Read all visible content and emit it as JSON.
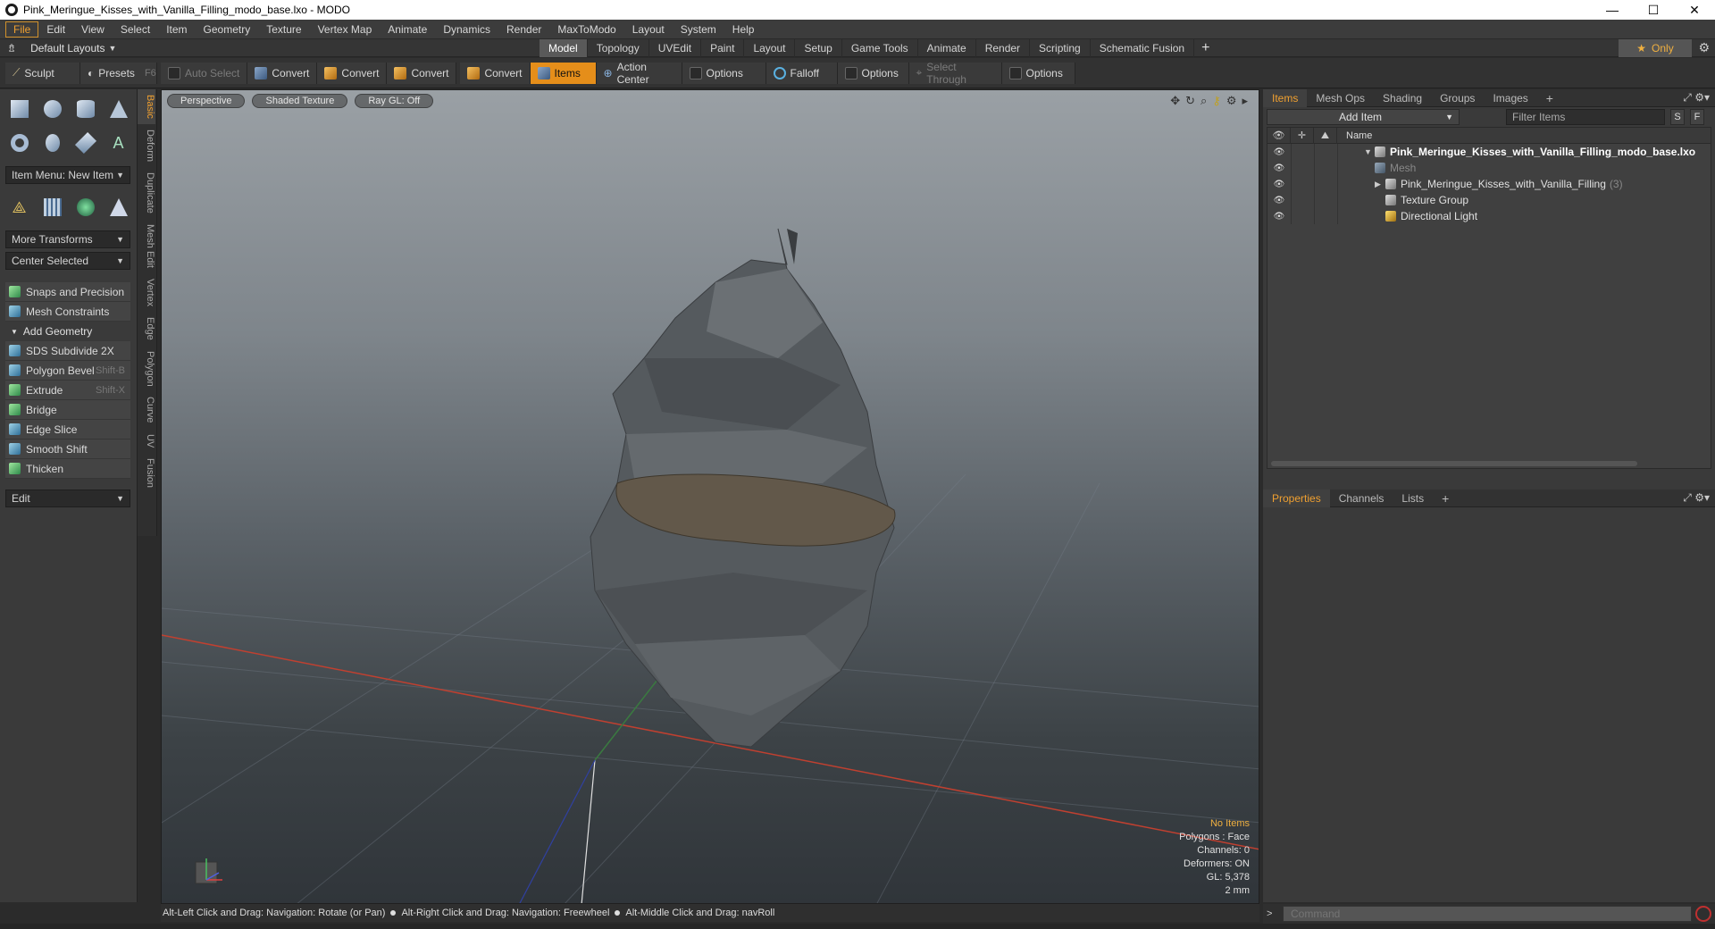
{
  "window": {
    "title": "Pink_Meringue_Kisses_with_Vanilla_Filling_modo_base.lxo - MODO",
    "controls": {
      "minimize": "—",
      "maximize": "☐",
      "close": "✕"
    }
  },
  "menubar": [
    "File",
    "Edit",
    "View",
    "Select",
    "Item",
    "Geometry",
    "Texture",
    "Vertex Map",
    "Animate",
    "Dynamics",
    "Render",
    "MaxToModo",
    "Layout",
    "System",
    "Help"
  ],
  "layoutbar": {
    "layouts_label": "Default Layouts",
    "tabs": [
      "Model",
      "Topology",
      "UVEdit",
      "Paint",
      "Layout",
      "Setup",
      "Game Tools",
      "Animate",
      "Render",
      "Scripting",
      "Schematic Fusion"
    ],
    "active_tab": "Model",
    "plus": "+",
    "only": "Only"
  },
  "toolbar": {
    "sculpt": "Sculpt",
    "presets": "Presets",
    "presets_key": "F6",
    "auto_select": "Auto Select",
    "convert": "Convert",
    "items": "Items",
    "action_center": "Action Center",
    "options": "Options",
    "falloff": "Falloff",
    "select_through": "Select Through"
  },
  "left": {
    "item_menu": "Item Menu: New Item",
    "more_transforms": "More Transforms",
    "center_selected": "Center Selected",
    "snaps": "Snaps and Precision",
    "constraints": "Mesh Constraints",
    "add_geometry": "Add Geometry",
    "tools": [
      {
        "label": "SDS Subdivide 2X",
        "shortcut": ""
      },
      {
        "label": "Polygon Bevel",
        "shortcut": "Shift-B"
      },
      {
        "label": "Extrude",
        "shortcut": "Shift-X"
      },
      {
        "label": "Bridge",
        "shortcut": ""
      },
      {
        "label": "Edge Slice",
        "shortcut": ""
      },
      {
        "label": "Smooth Shift",
        "shortcut": ""
      },
      {
        "label": "Thicken",
        "shortcut": ""
      }
    ],
    "edit": "Edit",
    "vtabs": [
      "Basic",
      "Deform",
      "Duplicate",
      "Mesh Edit",
      "Vertex",
      "Edge",
      "Polygon",
      "Curve",
      "UV",
      "Fusion"
    ]
  },
  "viewport": {
    "view": "Perspective",
    "shading": "Shaded Texture",
    "raygl": "Ray GL: Off",
    "info": {
      "items": "No Items",
      "polygons": "Polygons : Face",
      "channels": "Channels: 0",
      "deformers": "Deformers: ON",
      "gl": "GL: 5,378",
      "scale": "2 mm"
    }
  },
  "items_panel": {
    "tabs": [
      "Items",
      "Mesh Ops",
      "Shading",
      "Groups",
      "Images"
    ],
    "add_item": "Add Item",
    "filter": "Filter Items",
    "s": "S",
    "f": "F",
    "name_col": "Name",
    "rows": [
      {
        "label": "Pink_Meringue_Kisses_with_Vanilla_Filling_modo_base.lxo",
        "count": ""
      },
      {
        "label": "Mesh",
        "count": ""
      },
      {
        "label": "Pink_Meringue_Kisses_with_Vanilla_Filling",
        "count": "(3)"
      },
      {
        "label": "Texture Group",
        "count": ""
      },
      {
        "label": "Directional Light",
        "count": ""
      }
    ]
  },
  "props_panel": {
    "tabs": [
      "Properties",
      "Channels",
      "Lists"
    ]
  },
  "statusbar": {
    "hint1": "Alt-Left Click and Drag: Navigation: Rotate (or Pan)",
    "hint2": "Alt-Right Click and Drag: Navigation: Freewheel",
    "hint3": "Alt-Middle Click and Drag: navRoll"
  },
  "command": {
    "placeholder": "Command"
  }
}
